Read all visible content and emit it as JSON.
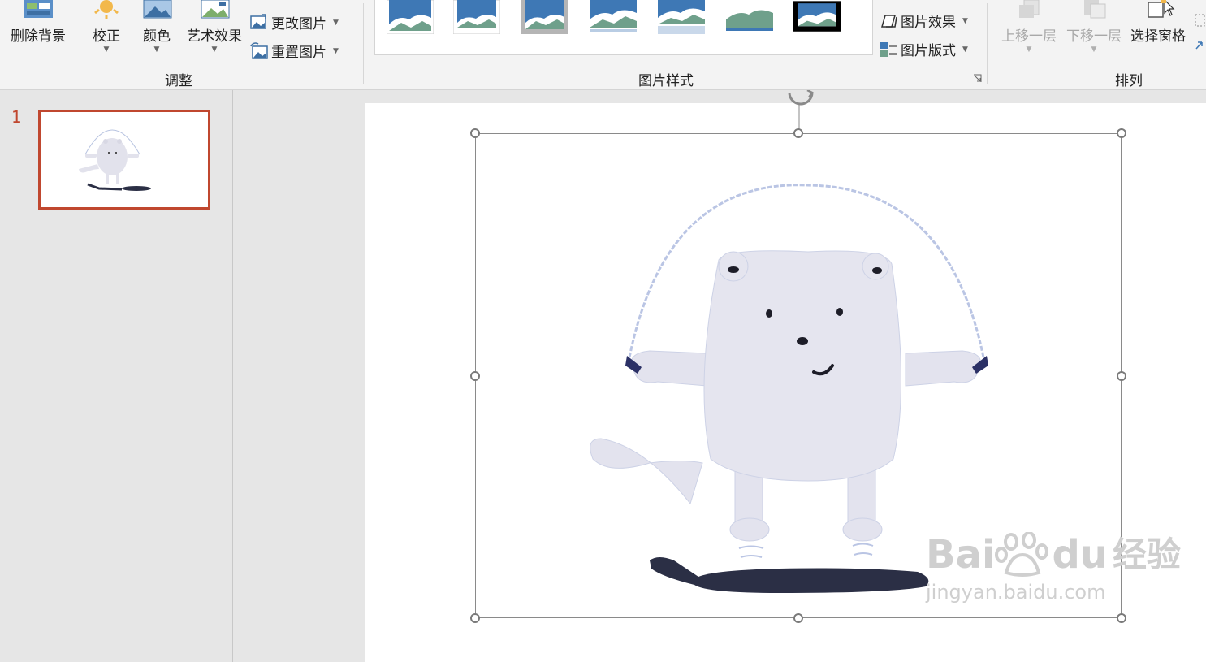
{
  "ribbon": {
    "adjust": {
      "remove_bg": "删除背景",
      "corrections": "校正",
      "color": "颜色",
      "artistic": "艺术效果",
      "change_picture": "更改图片",
      "reset_picture": "重置图片",
      "group_label": "调整"
    },
    "styles": {
      "picture_effects": "图片效果",
      "picture_layout": "图片版式",
      "group_label": "图片样式"
    },
    "arrange": {
      "bring_forward": "上移一层",
      "send_backward": "下移一层",
      "selection_pane": "选择窗格",
      "group_label": "排列"
    }
  },
  "slides": {
    "current_number": "1"
  },
  "watermark": {
    "brand": "Bai",
    "brand2": "du",
    "cn": "经验",
    "url": "jingyan.baidu.com"
  },
  "colors": {
    "accent": "#c0472f",
    "ribbon_bg": "#f3f3f3",
    "pane_bg": "#e6e6e6"
  }
}
